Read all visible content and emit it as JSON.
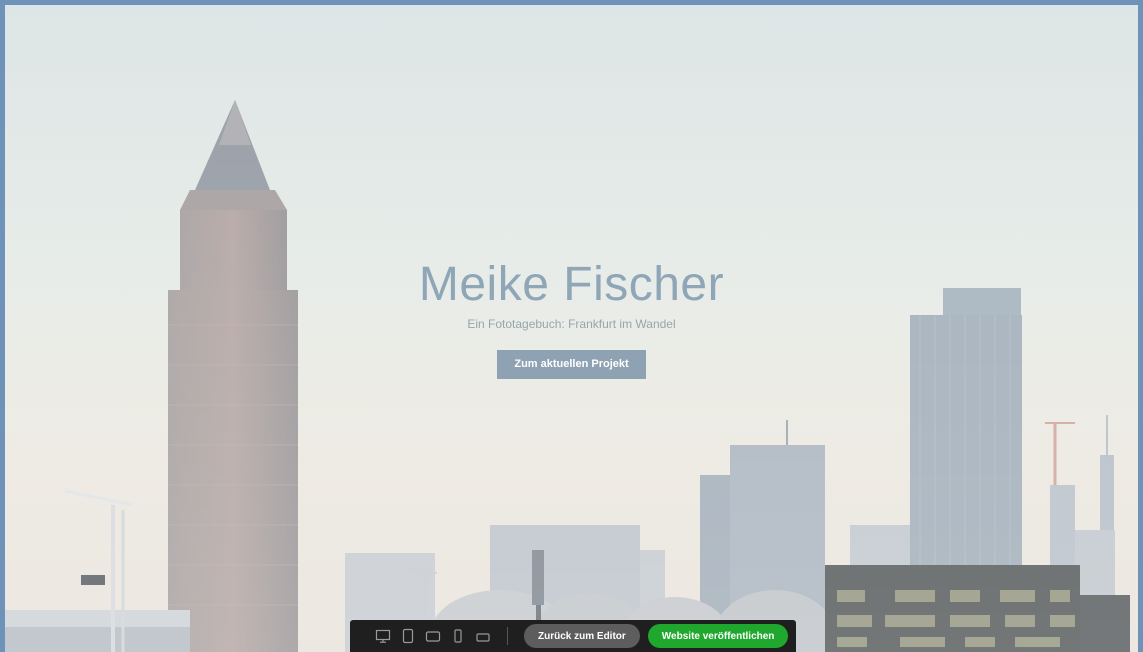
{
  "hero": {
    "title": "Meike Fischer",
    "subtitle": "Ein Fototagebuch: Frankfurt im Wandel",
    "cta_label": "Zum aktuellen Projekt"
  },
  "toolbar": {
    "devices": [
      "desktop-icon",
      "tablet-portrait-icon",
      "tablet-landscape-icon",
      "phone-portrait-icon",
      "phone-landscape-icon"
    ],
    "back_label": "Zurück zum Editor",
    "publish_label": "Website veröffentlichen"
  },
  "colors": {
    "title": "#8fa6b6",
    "cta_bg": "#8ea2b3",
    "toolbar_bg": "#1f1f1f",
    "publish_bg": "#1fa82d",
    "back_bg": "#5d5d5d"
  }
}
